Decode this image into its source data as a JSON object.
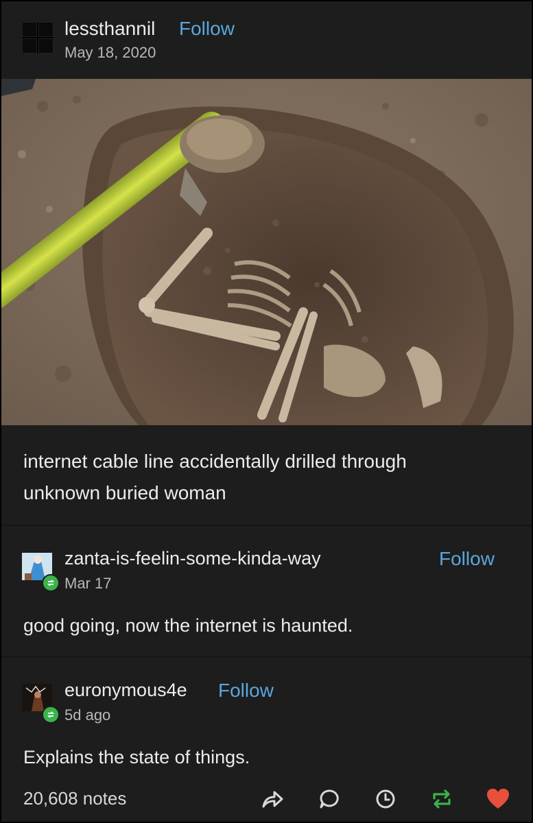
{
  "post": {
    "username": "lessthannil",
    "follow_label": "Follow",
    "date": "May 18, 2020",
    "caption_line1": "internet cable line accidentally drilled through",
    "caption_line2": "unknown buried woman"
  },
  "reblogs": [
    {
      "username": "zanta-is-feelin-some-kinda-way",
      "follow_label": "Follow",
      "date": "Mar 17",
      "text": "good going, now the internet is haunted."
    },
    {
      "username": "euronymous4e",
      "follow_label": "Follow",
      "date": "5d ago",
      "text": "Explains the state of things."
    }
  ],
  "footer": {
    "notes": "20,608 notes",
    "actions": [
      "share-icon",
      "reply-icon",
      "clock-icon",
      "reblog-icon",
      "heart-icon"
    ]
  },
  "colors": {
    "background": "#1d1d1d",
    "follow_link": "#5aa7de",
    "reblog_green": "#3bb34a",
    "like_red": "#e8503c"
  }
}
